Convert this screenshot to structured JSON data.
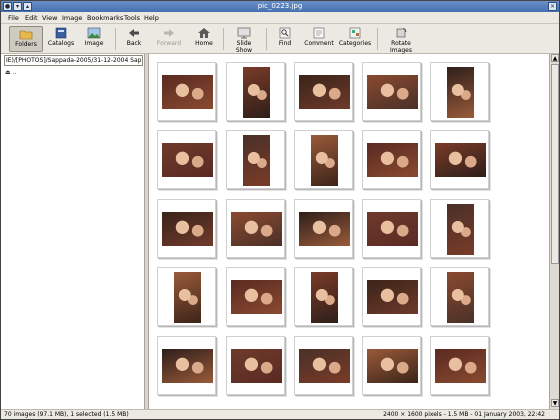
{
  "window": {
    "title": "pic_0223.jpg"
  },
  "menu": [
    "File",
    "Edit",
    "View",
    "Image",
    "Bookmarks",
    "Tools",
    "Help"
  ],
  "toolbar": {
    "folders": "Folders",
    "catalogs": "Catalogs",
    "image": "Image",
    "back": "Back",
    "forward": "Forward",
    "home": "Home",
    "slideshow": "Slide Show",
    "find": "Find",
    "comment": "Comment",
    "categories": "Categories",
    "rotate": "Rotate Images"
  },
  "sidebar": {
    "path": "IE)/[PHOTOS]/Sappada-2005/31-12-2004 Sappada",
    "updir": ".."
  },
  "status": {
    "left": "70 images (97.1 MB), 1 selected (1.5 MB)",
    "right": "2400 × 1600 pixels - 1.5 MB - 01 January 2003, 22:42"
  },
  "colors": {
    "titlebar": "#4470b0",
    "accent": "#cfcbc1"
  }
}
